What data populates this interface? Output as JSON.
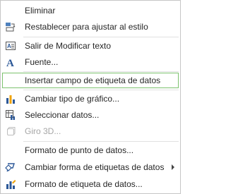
{
  "menu": {
    "items": [
      {
        "label": "Eliminar",
        "icon": "none"
      },
      {
        "label": "Restablecer para ajustar al estilo",
        "icon": "reset-style-icon"
      },
      {
        "label": "Salir de Modificar texto",
        "icon": "text-box-icon"
      },
      {
        "label": "Fuente...",
        "icon": "font-icon"
      },
      {
        "label": "Insertar campo de etiqueta de datos",
        "icon": "none",
        "highlighted": true
      },
      {
        "label": "Cambiar tipo de gráfico...",
        "icon": "bar-chart-icon"
      },
      {
        "label": "Seleccionar datos...",
        "icon": "select-data-icon"
      },
      {
        "label": "Giro 3D...",
        "icon": "3d-rotation-icon",
        "disabled": true
      },
      {
        "label": "Formato de punto de datos...",
        "icon": "none"
      },
      {
        "label": "Cambiar forma de etiquetas de datos",
        "icon": "shape-change-icon",
        "has_submenu": true
      },
      {
        "label": "Formato de etiqueta de datos...",
        "icon": "format-data-label-icon"
      }
    ]
  },
  "colors": {
    "highlight_border": "#7cc26e",
    "text": "#262626",
    "disabled_text": "#a6a6a6",
    "accent_blue": "#2b5797"
  }
}
